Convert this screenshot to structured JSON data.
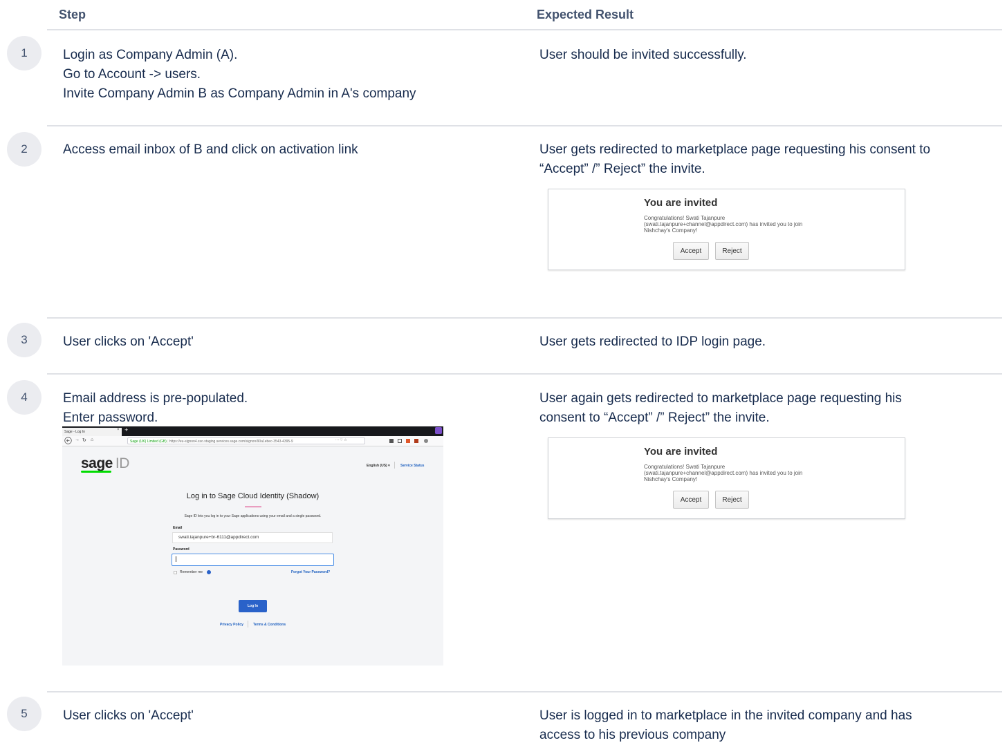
{
  "headers": {
    "step": "Step",
    "expected": "Expected Result"
  },
  "rows": [
    {
      "num": "1",
      "step_lines": [
        "Login as Company Admin (A).",
        "Go to Account -> users.",
        "Invite Company Admin B as Company Admin in A's company"
      ],
      "expected_lines": [
        "User should be invited successfully."
      ]
    },
    {
      "num": "2",
      "step_lines": [
        "Access email inbox of B and click on activation link"
      ],
      "expected_lines": [
        "User gets redirected to marketplace page requesting his consent to",
        "“Accept” /” Reject” the invite."
      ]
    },
    {
      "num": "3",
      "step_lines": [
        "User clicks on 'Accept'"
      ],
      "expected_lines": [
        "User gets redirected to IDP login page."
      ]
    },
    {
      "num": "4",
      "step_lines": [
        "Email address is pre-populated.",
        "Enter password."
      ],
      "expected_lines": [
        "User again gets redirected to marketplace page requesting his",
        "consent to “Accept” /” Reject” the invite."
      ]
    },
    {
      "num": "5",
      "step_lines": [
        "User clicks on 'Accept'"
      ],
      "expected_lines": [
        "User is logged in to marketplace in the invited company and has",
        "access to his previous company"
      ]
    }
  ],
  "invite_card": {
    "title": "You are invited",
    "message_lines": [
      "Congratulations! Swati Tajanpure",
      "(swati.tajanpure+channel@appdirect.com) has invited you to join",
      "Nishchay's Company!"
    ],
    "accept_label": "Accept",
    "reject_label": "Reject"
  },
  "login_screenshot": {
    "tab_title": "Sage - Log In",
    "tab_close": "×",
    "tab_new": "+",
    "url_identity": "Sage (UK) Limited (GB)",
    "url": "https://eu-signon4.sso.staging.services.sage.com/signon/90a1ebec-3543-4395-9",
    "url_menu": "··· ♡ ☆",
    "logo_main": "sage",
    "logo_suffix": "ID",
    "language": "English (US)",
    "service_status": "Service Status",
    "heading": "Log in to Sage Cloud Identity (Shadow)",
    "subtext": "Sage ID lets you log in to your Sage applications using your email and a single password.",
    "email_label": "Email",
    "email_value": "swati.tajanpure+br-6111@appdirect.com",
    "password_label": "Password",
    "password_value": "",
    "remember_me": "Remember me",
    "forgot_password": "Forgot Your Password?",
    "login_button": "Log In",
    "privacy_policy": "Privacy Policy",
    "terms": "Terms & Conditions",
    "colors": {
      "brand_green": "#00dc00",
      "button_blue": "#2a62c9",
      "accent_pink": "#d9196b",
      "link_blue": "#1d5fbf"
    }
  }
}
